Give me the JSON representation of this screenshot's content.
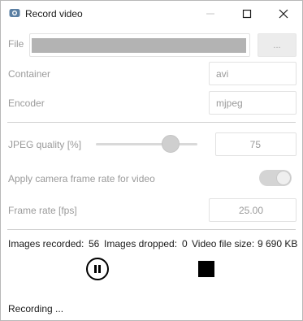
{
  "window": {
    "title": "Record video",
    "icon": "camera-app-icon"
  },
  "file": {
    "label": "File",
    "browse_label": "..."
  },
  "container": {
    "label": "Container",
    "value": "avi"
  },
  "encoder": {
    "label": "Encoder",
    "value": "mjpeg"
  },
  "jpeg_quality": {
    "label": "JPEG quality [%]",
    "value": "75",
    "slider_level_percent": 75
  },
  "camera_rate": {
    "label": "Apply camera frame rate for video",
    "enabled": true
  },
  "frame_rate": {
    "label": "Frame rate [fps]",
    "value": "25.00"
  },
  "stats": {
    "images_recorded_label": "Images recorded:",
    "images_recorded_value": "56",
    "images_dropped_label": "Images dropped:",
    "images_dropped_value": "0",
    "file_size_label": "Video file size:",
    "file_size_value": "9 690 KB"
  },
  "controls": {
    "pause_icon": "pause-circle-icon",
    "stop_icon": "stop-square-icon"
  },
  "status": {
    "text": "Recording ..."
  },
  "colors": {
    "disabled_text": "#9a9a9a",
    "title_text": "#1a1a1a",
    "file_path_bar": "#b3b3b3"
  }
}
